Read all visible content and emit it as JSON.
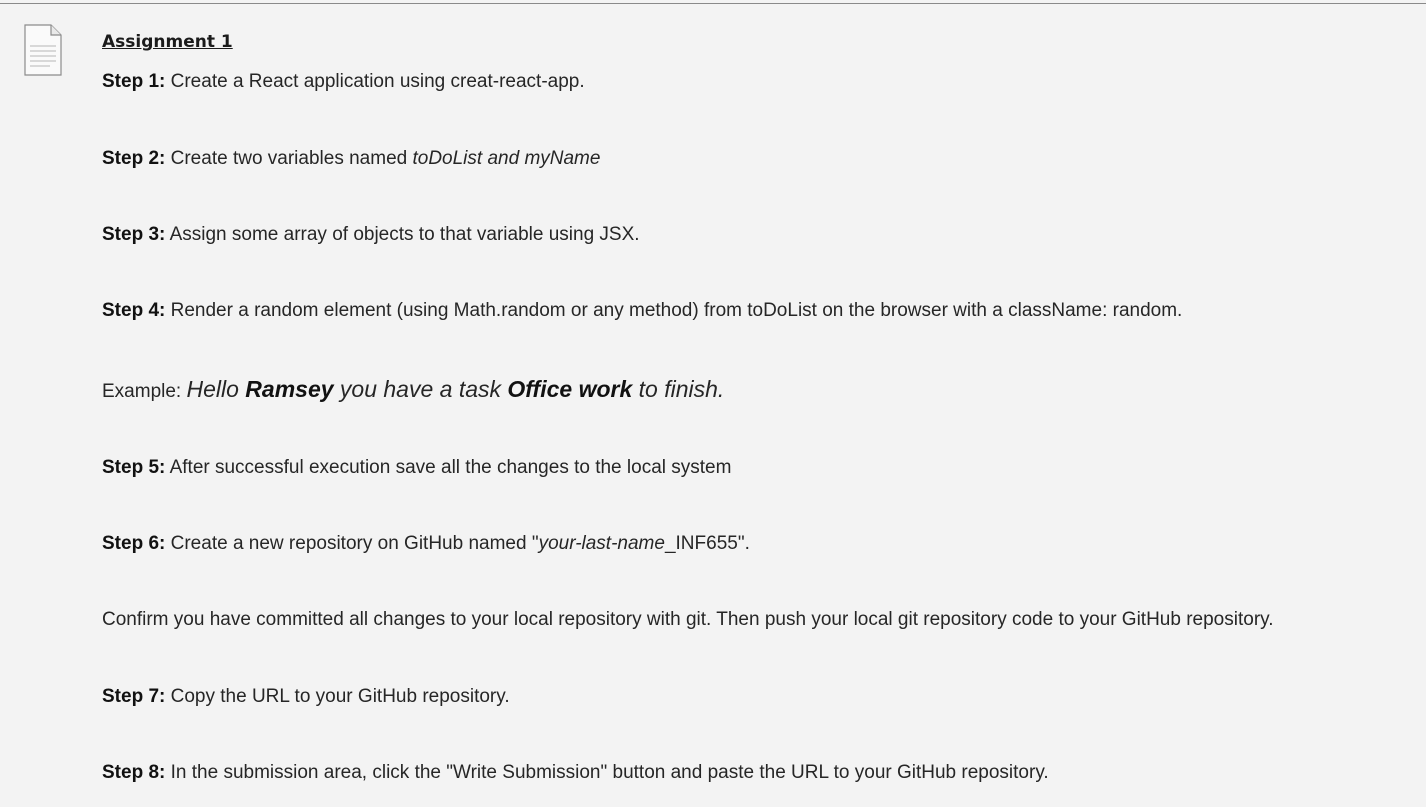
{
  "title": "Assignment 1",
  "steps": {
    "s1": {
      "label": "Step 1:",
      "text": " Create a React application using creat-react-app."
    },
    "s2": {
      "label": "Step 2:",
      "text": " Create two variables named ",
      "italic": "toDoList and myName"
    },
    "s3": {
      "label": "Step 3:",
      "text": " Assign some array of objects to that variable using JSX."
    },
    "s4": {
      "label": "Step 4:",
      "text": " Render a random element (using Math.random or any method) from toDoList on the browser with a className: random."
    },
    "example": {
      "prefix": "Example: ",
      "p1": "Hello ",
      "name": "Ramsey",
      "p2": " you have a task ",
      "task": "Office work",
      "p3": " to finish."
    },
    "s5": {
      "label": "Step 5:",
      "text": " After successful execution save all the changes to the local system"
    },
    "s6": {
      "label": "Step 6:",
      "text_pre": " Create a new repository on GitHub named \"",
      "italic": "your-last-name",
      "text_post": "_INF655\"."
    },
    "confirm": "Confirm you have committed all changes to your local repository with git. Then push your local git repository code to your GitHub repository.",
    "s7": {
      "label": "Step 7:",
      "text": " Copy the URL to your GitHub repository."
    },
    "s8": {
      "label": "Step 8:",
      "text": " In the submission area, click the \"Write Submission\" button and paste the URL to your GitHub repository."
    }
  },
  "icons": {
    "document": "document-icon"
  }
}
